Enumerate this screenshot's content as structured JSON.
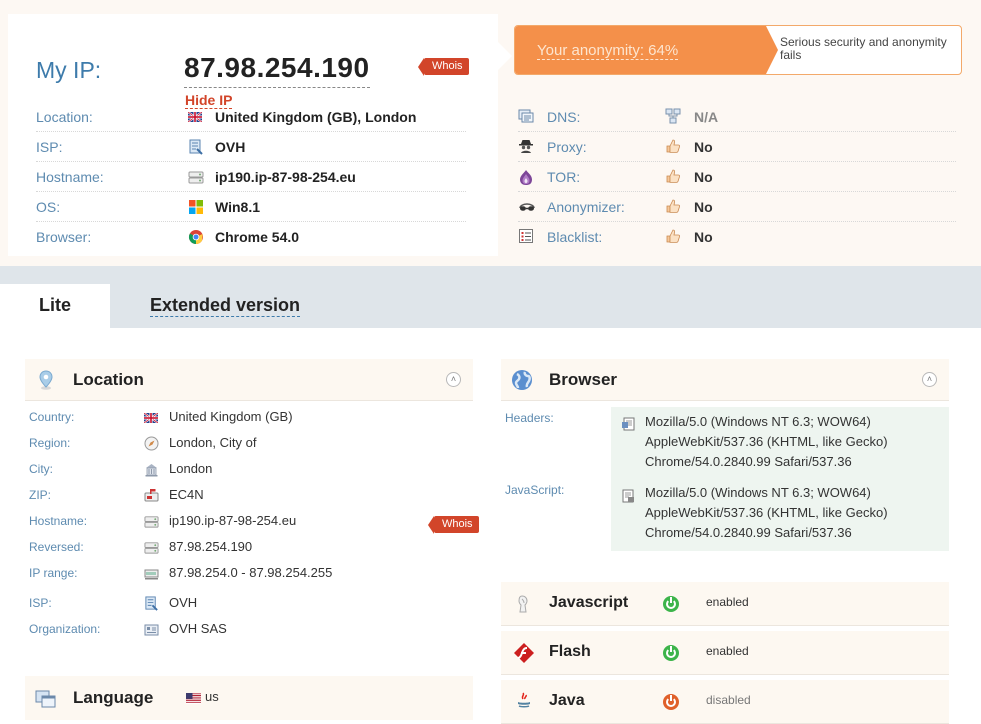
{
  "header": {
    "my_ip_label": "My IP:",
    "ip": "87.98.254.190",
    "hide_ip": "Hide IP",
    "whois": "Whois"
  },
  "summary": [
    {
      "label": "Location:",
      "value": "United Kingdom (GB), London",
      "icon": "uk-flag-icon"
    },
    {
      "label": "ISP:",
      "value": "OVH",
      "icon": "isp-icon"
    },
    {
      "label": "Hostname:",
      "value": "ip190.ip-87-98-254.eu",
      "icon": "server-icon"
    },
    {
      "label": "OS:",
      "value": "Win8.1",
      "icon": "windows-icon"
    },
    {
      "label": "Browser:",
      "value": "Chrome 54.0",
      "icon": "chrome-icon"
    }
  ],
  "anonymity": {
    "label": "Your anonymity: 64%",
    "percent": 64,
    "note": "Serious security and anonymity fails",
    "bar_color": "#f4904a"
  },
  "checks": [
    {
      "label": "DNS:",
      "value": "N/A",
      "icon": "dns-icon",
      "status_icon": "network-icon"
    },
    {
      "label": "Proxy:",
      "value": "No",
      "icon": "spy-icon",
      "status_icon": "thumbs-up-icon"
    },
    {
      "label": "TOR:",
      "value": "No",
      "icon": "tor-onion-icon",
      "status_icon": "thumbs-up-icon"
    },
    {
      "label": "Anonymizer:",
      "value": "No",
      "icon": "goggles-icon",
      "status_icon": "thumbs-up-icon"
    },
    {
      "label": "Blacklist:",
      "value": "No",
      "icon": "list-icon",
      "status_icon": "thumbs-up-icon"
    }
  ],
  "tabs": [
    {
      "label": "Lite",
      "active": true
    },
    {
      "label": "Extended version",
      "active": false
    }
  ],
  "location_card": {
    "title": "Location",
    "rows": [
      {
        "label": "Country:",
        "value": "United Kingdom (GB)",
        "icon": "uk-flag-icon"
      },
      {
        "label": "Region:",
        "value": "London, City of",
        "icon": "compass-icon"
      },
      {
        "label": "City:",
        "value": "London",
        "icon": "building-icon"
      },
      {
        "label": "ZIP:",
        "value": "EC4N",
        "icon": "mailbox-icon"
      },
      {
        "label": "Hostname:",
        "value": "ip190.ip-87-98-254.eu",
        "icon": "server-icon"
      },
      {
        "label": "Reversed:",
        "value": "87.98.254.190",
        "icon": "server-icon"
      },
      {
        "label": "IP range:",
        "value": "87.98.254.0 - 87.98.254.255",
        "icon": "ip-range-icon"
      },
      {
        "label": "ISP:",
        "value": "OVH",
        "icon": "isp-icon"
      },
      {
        "label": "Organization:",
        "value": "OVH SAS",
        "icon": "organization-icon"
      }
    ],
    "whois": "Whois"
  },
  "browser_card": {
    "title": "Browser",
    "headers_label": "Headers:",
    "headers_value": "Mozilla/5.0 (Windows NT 6.3; WOW64) AppleWebKit/537.36 (KHTML, like Gecko) Chrome/54.0.2840.99 Safari/537.36",
    "js_label": "JavaScript:",
    "js_value": "Mozilla/5.0 (Windows NT 6.3; WOW64) AppleWebKit/537.36 (KHTML, like Gecko) Chrome/54.0.2840.99 Safari/537.36"
  },
  "features": [
    {
      "name": "Javascript",
      "status": "enabled",
      "on": true,
      "icon": "javascript-icon"
    },
    {
      "name": "Flash",
      "status": "enabled",
      "on": true,
      "icon": "flash-icon"
    },
    {
      "name": "Java",
      "status": "disabled",
      "on": false,
      "icon": "java-icon"
    }
  ],
  "language": {
    "title": "Language",
    "value": "us",
    "icon": "us-flag-icon"
  },
  "colors": {
    "accent_blue": "#3d7bab",
    "label_blue": "#5e8bb0",
    "whois_red": "#d2452a",
    "enabled_green": "#3cb44a",
    "disabled_orange": "#e0602a"
  }
}
